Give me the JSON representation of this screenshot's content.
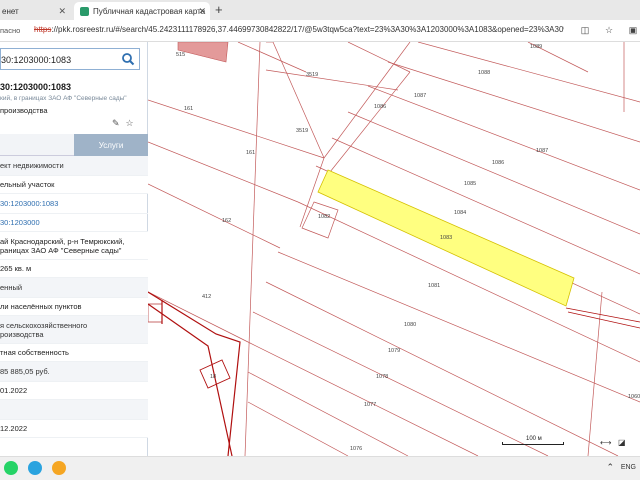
{
  "browser": {
    "tabs": [
      {
        "label": "енет"
      },
      {
        "label": "Публичная кадастровая карта"
      }
    ],
    "address": {
      "secure_label": "пасно",
      "scheme": "https",
      "url_rest": "://pkk.rosreestr.ru/#/search/45.2423111178926,37.44699730842822/17/@5w3tqw5ca?text=23%3A30%3A1203000%3A1083&opened=23%3A30%3A"
    }
  },
  "panel": {
    "search_value": "30:1203000:1083",
    "object_title": "30:1203000:1083",
    "object_subtitle": "кий, в границах ЗАО АФ \"Северные сады\"",
    "object_purpose": "производства",
    "tab_services": "Услуги",
    "rows": [
      {
        "text": "ект недвижимости",
        "kind": "head",
        "h": 20
      },
      {
        "text": "ельный участок",
        "kind": "val",
        "h": 18
      },
      {
        "text": "30:1203000:1083",
        "kind": "link",
        "h": 20
      },
      {
        "text": "30:1203000",
        "kind": "link",
        "h": 18
      },
      {
        "text": "ай Краснодарский, р-н Темрюкский,\nраницах ЗАО АФ \"Северные сады\"",
        "kind": "val",
        "h": 28
      },
      {
        "text": "265 кв. м",
        "kind": "val",
        "h": 18
      },
      {
        "text": "енный",
        "kind": "head",
        "h": 20
      },
      {
        "text": "ли населённых пунктов",
        "kind": "val",
        "h": 18
      },
      {
        "text": "я сельскохозяйственного\nроизводства",
        "kind": "head",
        "h": 28
      },
      {
        "text": "тная собственность",
        "kind": "val",
        "h": 18
      },
      {
        "text": "85 885,05 руб.",
        "kind": "head",
        "h": 20
      },
      {
        "text": "01.2022",
        "kind": "val",
        "h": 18
      },
      {
        "text": "",
        "kind": "head",
        "h": 20
      },
      {
        "text": "12.2022",
        "kind": "val",
        "h": 18
      }
    ]
  },
  "map": {
    "highlight_color": "#ffff80",
    "parcel_line_color": "#c25a5a",
    "boundary_color": "#b01010",
    "parcels": [
      "1089",
      "1088",
      "3519",
      "1087",
      "1086",
      "3519",
      "161",
      "161",
      "1087",
      "1086",
      "1085",
      "1082",
      "1084",
      "162",
      "1083",
      "1081",
      "412",
      "1080",
      "1079",
      "1078",
      "18",
      "1077",
      "1076",
      "1060",
      "515"
    ],
    "scale_label": "100 м"
  },
  "taskbar": {
    "lang": "ENG"
  }
}
